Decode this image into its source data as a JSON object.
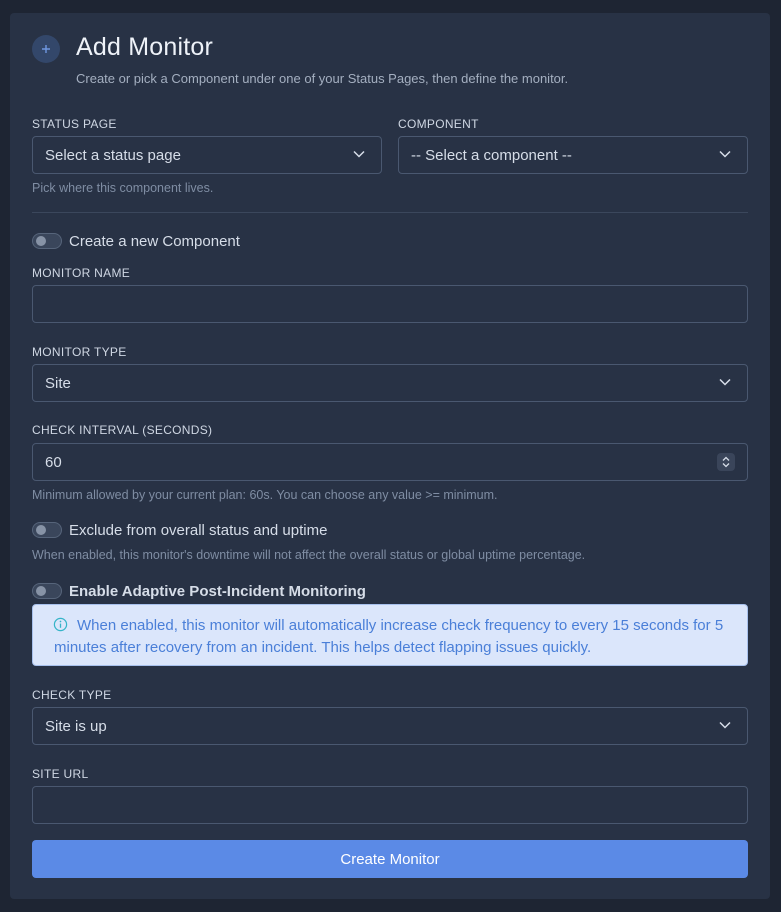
{
  "header": {
    "icon": "plus-icon",
    "title": "Add Monitor",
    "subtitle": "Create or pick a Component under one of your Status Pages, then define the monitor."
  },
  "status_page": {
    "label": "STATUS PAGE",
    "selected": "Select a status page",
    "help": "Pick where this component lives."
  },
  "component": {
    "label": "COMPONENT",
    "selected": "-- Select a component --"
  },
  "create_component": {
    "label": "Create a new Component",
    "enabled": false
  },
  "monitor_name": {
    "label": "MONITOR NAME",
    "value": ""
  },
  "monitor_type": {
    "label": "MONITOR TYPE",
    "selected": "Site"
  },
  "check_interval": {
    "label": "CHECK INTERVAL (SECONDS)",
    "value": "60",
    "help": "Minimum allowed by your current plan: 60s. You can choose any value >= minimum."
  },
  "exclude": {
    "label": "Exclude from overall status and uptime",
    "enabled": false,
    "help": "When enabled, this monitor's downtime will not affect the overall status or global uptime percentage."
  },
  "adaptive": {
    "label": "Enable Adaptive Post-Incident Monitoring",
    "enabled": false,
    "info_icon": "info-circle-icon",
    "info": "When enabled, this monitor will automatically increase check frequency to every 15 seconds for 5 minutes after recovery from an incident. This helps detect flapping issues quickly."
  },
  "check_type": {
    "label": "CHECK TYPE",
    "selected": "Site is up"
  },
  "site_url": {
    "label": "SITE URL",
    "value": ""
  },
  "submit": {
    "label": "Create Monitor"
  },
  "colors": {
    "background": "#1e2533",
    "card": "#283245",
    "accent": "#5b8ae6",
    "info_bg": "#dbe6fb",
    "info_text": "#4a7fd8"
  }
}
